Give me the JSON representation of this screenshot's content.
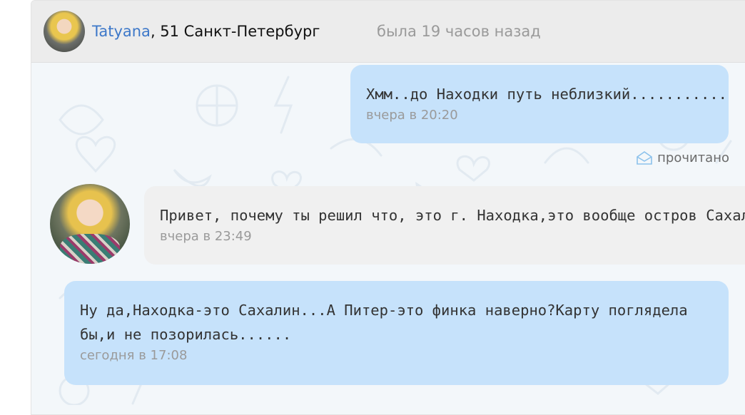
{
  "header": {
    "user_name": "Tatyana",
    "user_details": ", 51 Санкт-Петербург",
    "last_seen": "была 19 часов назад"
  },
  "messages": [
    {
      "direction": "outgoing",
      "text_lines": [
        "Хмм..до Находки путь неблизкий..........."
      ],
      "time": "вчера в 20:20",
      "status": "прочитано"
    },
    {
      "direction": "incoming",
      "text_lines": [
        "Привет, почему ты решил что, это г. Находка,это вообще остров Сахалин"
      ],
      "time": "вчера в 23:49"
    },
    {
      "direction": "outgoing",
      "text_lines": [
        "Ну да,Находка-это Сахалин...А Питер-это финка наверно?Карту поглядела",
        "бы,и не позорилась......"
      ],
      "time": "сегодня в 17:08"
    }
  ],
  "colors": {
    "outgoing_bubble": "#c6e2fb",
    "incoming_bubble": "#f0f0f0",
    "username_link": "#3d78c9",
    "muted_text": "#9a9a9a"
  },
  "icons": {
    "read_status": "envelope-open-icon"
  }
}
